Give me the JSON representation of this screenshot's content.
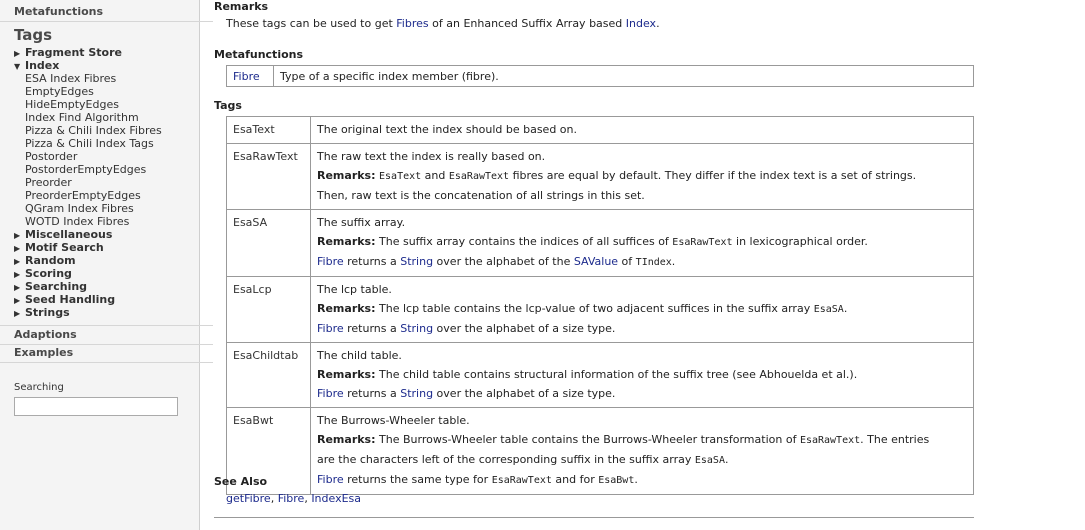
{
  "sidebar": {
    "metafunctions": "Metafunctions",
    "tags_title": "Tags",
    "tree": [
      {
        "label": "Fragment Store",
        "type": "cat",
        "expanded": false
      },
      {
        "label": "Index",
        "type": "cat",
        "expanded": true
      },
      {
        "label": "ESA Index Fibres",
        "type": "sub"
      },
      {
        "label": "EmptyEdges",
        "type": "sub"
      },
      {
        "label": "HideEmptyEdges",
        "type": "sub"
      },
      {
        "label": "Index Find Algorithm",
        "type": "sub"
      },
      {
        "label": "Pizza & Chili Index Fibres",
        "type": "sub"
      },
      {
        "label": "Pizza & Chili Index Tags",
        "type": "sub"
      },
      {
        "label": "Postorder",
        "type": "sub"
      },
      {
        "label": "PostorderEmptyEdges",
        "type": "sub"
      },
      {
        "label": "Preorder",
        "type": "sub"
      },
      {
        "label": "PreorderEmptyEdges",
        "type": "sub"
      },
      {
        "label": "QGram Index Fibres",
        "type": "sub"
      },
      {
        "label": "WOTD Index Fibres",
        "type": "sub"
      },
      {
        "label": "Miscellaneous",
        "type": "cat",
        "expanded": false
      },
      {
        "label": "Motif Search",
        "type": "cat",
        "expanded": false
      },
      {
        "label": "Random",
        "type": "cat",
        "expanded": false
      },
      {
        "label": "Scoring",
        "type": "cat",
        "expanded": false
      },
      {
        "label": "Searching",
        "type": "cat",
        "expanded": false
      },
      {
        "label": "Seed Handling",
        "type": "cat",
        "expanded": false
      },
      {
        "label": "Strings",
        "type": "cat",
        "expanded": false
      }
    ],
    "adaptions": "Adaptions",
    "examples": "Examples",
    "search_label": "Searching",
    "search_value": ""
  },
  "main": {
    "remarks_heading": "Remarks",
    "remarks_pre": "These tags can be used to get ",
    "remarks_link1": "Fibres",
    "remarks_mid": " of an Enhanced Suffix Array based ",
    "remarks_link2": "Index",
    "remarks_post": ".",
    "meta_heading": "Metafunctions",
    "meta_name": "Fibre",
    "meta_desc": "Type of a specific index member (fibre).",
    "tags_heading": "Tags",
    "tags": {
      "esatext": {
        "name": "EsaText",
        "desc": "The original text the index should be based on."
      },
      "esarawtext": {
        "name": "EsaRawText",
        "desc": "The raw text the index is really based on.",
        "remarks_label": "Remarks:",
        "r1": "EsaText",
        "r2": " and ",
        "r3": "EsaRawText",
        "r4": " fibres are equal by default. They differ if the index text is a set of strings.",
        "r5": "Then, raw text is the concatenation of all strings in this set."
      },
      "esasa": {
        "name": "EsaSA",
        "desc": "The suffix array.",
        "remarks_label": "Remarks:",
        "r1": " The suffix array contains the indices of all suffices of ",
        "r2": "EsaRawText",
        "r3": " in lexicographical order.",
        "f1": "Fibre",
        "f2": " returns a ",
        "f3": "String",
        "f4": " over the alphabet of the ",
        "f5": "SAValue",
        "f6": " of ",
        "f7": "TIndex",
        "f8": "."
      },
      "esalcp": {
        "name": "EsaLcp",
        "desc": "The lcp table.",
        "remarks_label": "Remarks:",
        "r1": " The lcp table contains the lcp-value of two adjacent suffices in the suffix array ",
        "r2": "EsaSA",
        "r3": ".",
        "f1": "Fibre",
        "f2": " returns a ",
        "f3": "String",
        "f4": " over the alphabet of a size type."
      },
      "esachildtab": {
        "name": "EsaChildtab",
        "desc": "The child table.",
        "remarks_label": "Remarks:",
        "r1": " The child table contains structural information of the suffix tree (see Abhouelda et al.).",
        "f1": "Fibre",
        "f2": " returns a ",
        "f3": "String",
        "f4": " over the alphabet of a size type."
      },
      "esabwt": {
        "name": "EsaBwt",
        "desc": "The Burrows-Wheeler table.",
        "remarks_label": "Remarks:",
        "r1": " The Burrows-Wheeler table contains the Burrows-Wheeler transformation of ",
        "r2": "EsaRawText",
        "r3": ". The entries",
        "r4": "are the characters left of the corresponding suffix in the suffix array ",
        "r5": "EsaSA",
        "r6": ".",
        "f1": "Fibre",
        "f2": " returns the same type for ",
        "f3": "EsaRawText",
        "f4": " and for ",
        "f5": "EsaBwt",
        "f6": "."
      }
    },
    "seealso_heading": "See Also",
    "seealso": {
      "l1": "getFibre",
      "sep1": ", ",
      "l2": "Fibre",
      "sep2": ", ",
      "l3": "IndexEsa"
    }
  }
}
